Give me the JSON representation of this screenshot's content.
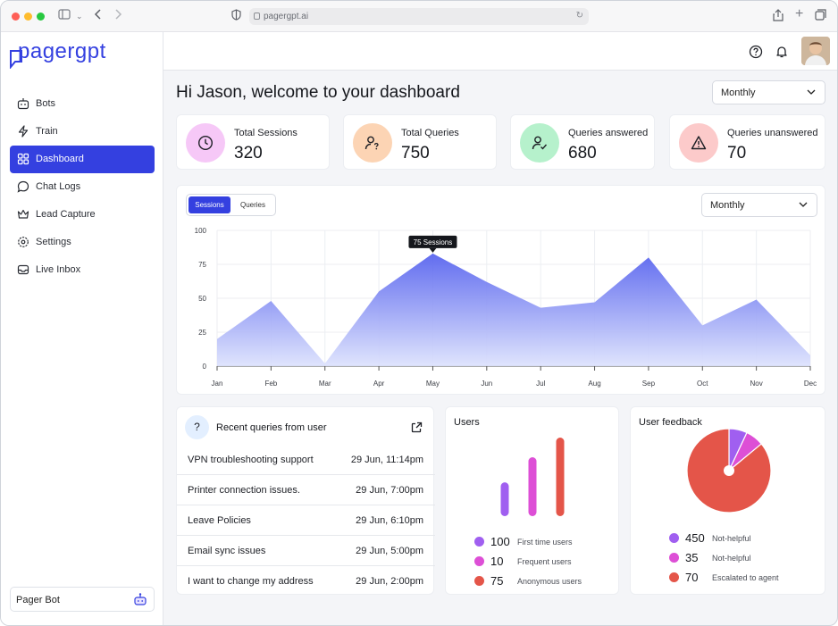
{
  "browser": {
    "url": "pagergpt.ai"
  },
  "sidebar": {
    "logo": "pagergpt",
    "items": [
      {
        "label": "Bots",
        "icon": "bot-icon"
      },
      {
        "label": "Train",
        "icon": "bolt-icon"
      },
      {
        "label": "Dashboard",
        "icon": "grid-icon",
        "active": true
      },
      {
        "label": "Chat Logs",
        "icon": "chat-icon"
      },
      {
        "label": "Lead Capture",
        "icon": "crown-icon"
      },
      {
        "label": "Settings",
        "icon": "gear-icon"
      },
      {
        "label": "Live Inbox",
        "icon": "inbox-icon"
      }
    ],
    "bot_selector": "Pager Bot"
  },
  "header": {
    "title": "Hi Jason, welcome to your dashboard",
    "period": "Monthly"
  },
  "stats": [
    {
      "label": "Total Sessions",
      "value": "320",
      "color": "#f6c8f7",
      "icon": "clock-icon"
    },
    {
      "label": "Total Queries",
      "value": "750",
      "color": "#fcd4b4",
      "icon": "user-question-icon"
    },
    {
      "label": "Queries answered",
      "value": "680",
      "color": "#b6f1cc",
      "icon": "user-check-icon"
    },
    {
      "label": "Queries unanswered",
      "value": "70",
      "color": "#fccaca",
      "icon": "warning-icon"
    }
  ],
  "chart_tabs": {
    "sessions": "Sessions",
    "queries": "Queries"
  },
  "chart_period": "Monthly",
  "chart_data": {
    "type": "area",
    "categories": [
      "Jan",
      "Feb",
      "Mar",
      "Apr",
      "May",
      "Jun",
      "Jul",
      "Aug",
      "Sep",
      "Oct",
      "Nov",
      "Dec"
    ],
    "series": [
      {
        "name": "Sessions",
        "values": [
          20,
          48,
          2,
          55,
          83,
          62,
          43,
          47,
          80,
          30,
          49,
          8
        ]
      }
    ],
    "ylim": [
      0,
      100
    ],
    "yticks": [
      0,
      25,
      50,
      75,
      100
    ],
    "grid": true,
    "tooltip": "75 Sessions",
    "color": "#5c66ee"
  },
  "recent_queries": {
    "title": "Recent queries from user",
    "rows": [
      {
        "text": "VPN troubleshooting support",
        "date": "29 Jun, 11:14pm"
      },
      {
        "text": "Printer connection issues.",
        "date": "29 Jun, 7:00pm"
      },
      {
        "text": "Leave Policies",
        "date": "29 Jun, 6:10pm"
      },
      {
        "text": "Email sync issues",
        "date": "29 Jun, 5:00pm"
      },
      {
        "text": "I want to change my address",
        "date": "29 Jun, 2:00pm"
      }
    ]
  },
  "users": {
    "title": "Users",
    "items": [
      {
        "value": "100",
        "label": "First time users",
        "color": "#a05ff0"
      },
      {
        "value": "10",
        "label": "Frequent users",
        "color": "#dd4fd6"
      },
      {
        "value": "75",
        "label": "Anonymous users",
        "color": "#e45549"
      }
    ],
    "bar_levels": [
      0.43,
      0.75,
      1.0
    ]
  },
  "feedback": {
    "title": "User feedback",
    "items": [
      {
        "value": "450",
        "label": "Not-helpful",
        "color": "#a05ff0"
      },
      {
        "value": "35",
        "label": "Not-helpful",
        "color": "#dd4fd6"
      },
      {
        "value": "70",
        "label": "Escalated to agent",
        "color": "#e45549"
      }
    ],
    "pie_shares": [
      0.07,
      0.07,
      0.86
    ]
  }
}
